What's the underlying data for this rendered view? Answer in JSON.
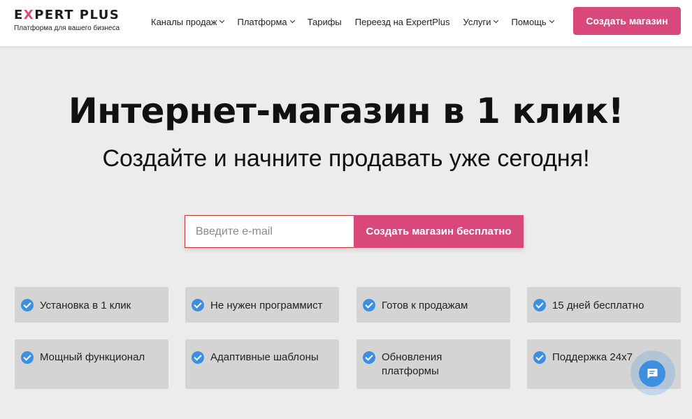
{
  "header": {
    "logo": {
      "title_pre": "E",
      "title_x": "X",
      "title_post": "PERT PLUS",
      "subtitle": "Платформа для вашего бизнеса"
    },
    "nav": [
      {
        "label": "Каналы продаж",
        "dropdown": true
      },
      {
        "label": "Платформа",
        "dropdown": true
      },
      {
        "label": "Тарифы",
        "dropdown": false
      },
      {
        "label": "Переезд на ExpertPlus",
        "dropdown": false
      },
      {
        "label": "Услуги",
        "dropdown": true
      },
      {
        "label": "Помощь",
        "dropdown": true
      }
    ],
    "cta_label": "Создать магазин"
  },
  "hero": {
    "title": "Интернет-магазин в 1 клик!",
    "subtitle": "Создайте и начните продавать уже сегодня!"
  },
  "signup": {
    "email_placeholder": "Введите e-mail",
    "email_value": "",
    "submit_label": "Создать магазин бесплатно"
  },
  "features": [
    "Установка в 1 клик",
    "Не нужен программист",
    "Готов к продажам",
    "15 дней бесплатно",
    "Мощный функционал",
    "Адаптивные шаблоны",
    "Обновления платформы",
    "Поддержка 24x7"
  ],
  "icons": {
    "feature": "check-circle-icon",
    "chat": "chat-bubble-icon",
    "nav_dropdown": "chevron-down-icon"
  },
  "colors": {
    "accent": "#d9487a",
    "check": "#3d8fe0",
    "background": "#ececec",
    "card": "#d4d4d4"
  }
}
